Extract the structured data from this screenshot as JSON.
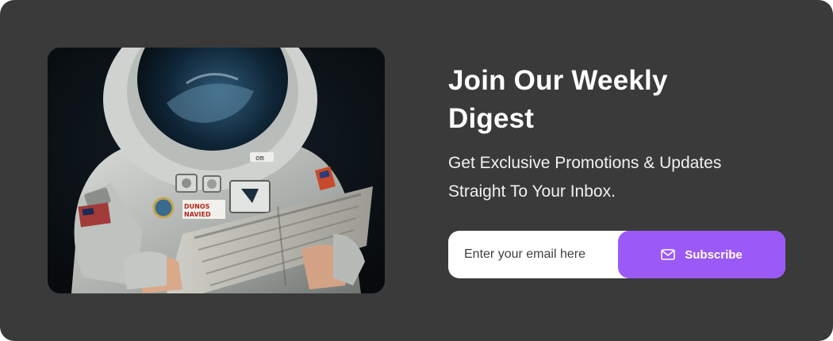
{
  "newsletter": {
    "title": "Join Our Weekly Digest",
    "subtitle": "Get Exclusive Promotions & Updates Straight To Your Inbox.",
    "email_placeholder": "Enter your email here",
    "subscribe_label": "Subscribe",
    "image": {
      "subject": "astronaut reading newspaper",
      "patch_text": "DUNOS NAVIED",
      "badge_text": "om"
    }
  },
  "colors": {
    "card_background": "#3a3a3a",
    "button_background": "#9b59f5",
    "text_primary": "#ffffff"
  },
  "icons": {
    "subscribe_icon": "mail-icon"
  }
}
